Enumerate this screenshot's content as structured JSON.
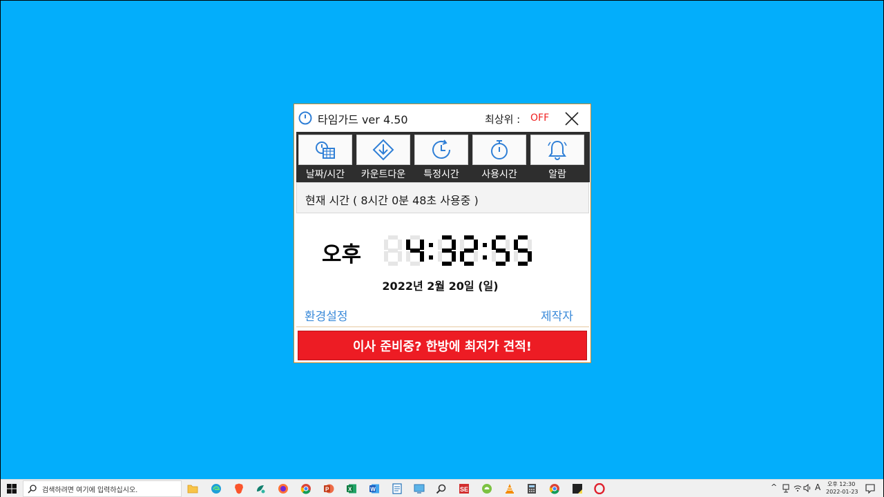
{
  "window": {
    "title": "타임가드 ver 4.50",
    "topmost_label": "최상위 :",
    "topmost_value": "OFF",
    "accent_color": "#ed1c24",
    "link_color": "#3a8ad9"
  },
  "toolbar": {
    "items": [
      {
        "label": "날짜/시간",
        "icon": "calendar-clock-icon"
      },
      {
        "label": "카운트다운",
        "icon": "download-arrow-icon"
      },
      {
        "label": "특정시간",
        "icon": "clock-refresh-icon"
      },
      {
        "label": "사용시간",
        "icon": "stopwatch-icon"
      },
      {
        "label": "알람",
        "icon": "bell-icon"
      }
    ]
  },
  "status": {
    "text": "현재 시간 ( 8시간  0분 48초 사용중 )"
  },
  "clock": {
    "ampm": "오후",
    "time": "4:32:55",
    "date": "2022년  2월 20일 (일)"
  },
  "links": {
    "settings": "환경설정",
    "author": "제작자"
  },
  "banner": {
    "text": "이사 준비중? 한방에 최저가 견적!"
  },
  "taskbar": {
    "search_placeholder": "검색하려면 여기에 입력하십시오.",
    "apps": [
      "file-explorer-icon",
      "edge-icon",
      "brave-icon",
      "app-icon",
      "firefox-icon",
      "chrome-icon",
      "powerpoint-icon",
      "excel-icon",
      "word-icon",
      "notepad-icon",
      "display-icon",
      "search-app-icon",
      "se-app-icon",
      "android-icon",
      "vlc-icon",
      "calculator-icon",
      "chrome-icon",
      "sticky-notes-icon",
      "opera-icon"
    ],
    "ime_indicator": "A",
    "clock_time": "오후 12:30",
    "clock_date": "2022-01-23"
  }
}
